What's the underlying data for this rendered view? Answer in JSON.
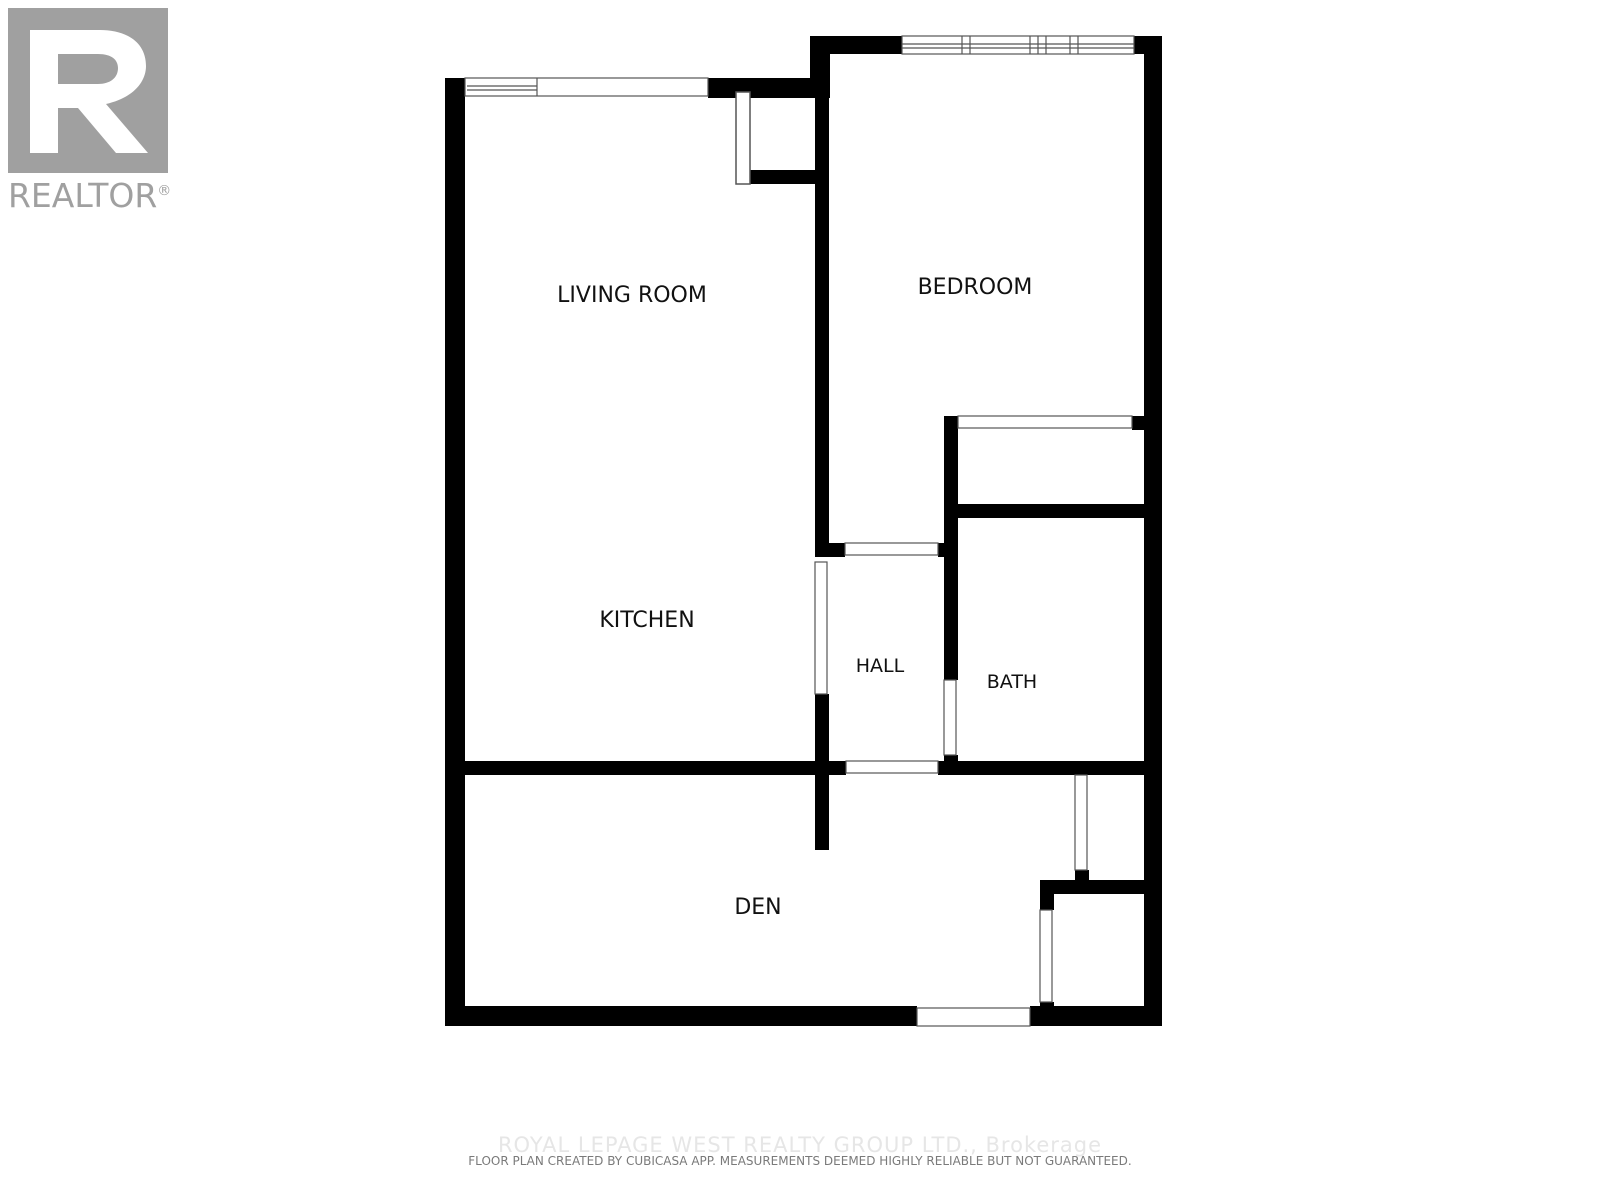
{
  "logo": {
    "text": "REALTOR",
    "mark": "®",
    "color": "#a0a0a0"
  },
  "rooms": {
    "living_room": "LIVING ROOM",
    "bedroom": "BEDROOM",
    "kitchen": "KITCHEN",
    "hall": "HALL",
    "bath": "BATH",
    "den": "DEN"
  },
  "watermark": "ROYAL LEPAGE WEST REALTY GROUP LTD., Brokerage",
  "disclaimer": "FLOOR PLAN CREATED BY CUBICASA APP. MEASUREMENTS DEEMED HIGHLY RELIABLE BUT NOT GUARANTEED.",
  "colors": {
    "wall": "#000000",
    "background": "#ffffff",
    "window_stroke": "#555555"
  }
}
